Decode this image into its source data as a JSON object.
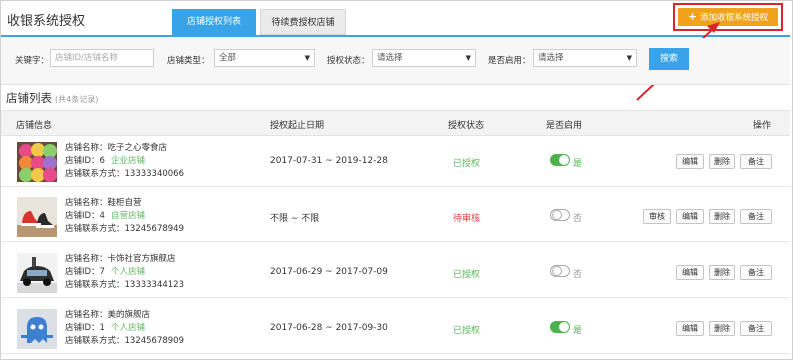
{
  "page_title": "收银系统授权",
  "tabs": [
    {
      "label": "店铺授权列表",
      "active": true
    },
    {
      "label": "待续费授权店铺",
      "active": false
    }
  ],
  "add_button": {
    "icon": "plus-icon",
    "label": "添加收银系统授权"
  },
  "filters": {
    "keyword": {
      "label": "关键字：",
      "placeholder": "店铺ID/店铺名称"
    },
    "shop_type": {
      "label": "店铺类型：",
      "value": "全部"
    },
    "auth_status": {
      "label": "授权状态：",
      "value": "请选择"
    },
    "enabled": {
      "label": "是否启用：",
      "value": "请选择"
    },
    "search_label": "搜索"
  },
  "list": {
    "title": "店铺列表",
    "count": "(共4条记录)"
  },
  "columns": [
    "店铺信息",
    "授权起止日期",
    "授权状态",
    "是否启用",
    "操作"
  ],
  "rows": [
    {
      "name": "店铺名称：吃子之心零食店",
      "id": "店铺ID：6",
      "type": "企业店铺",
      "phone": "店铺联系方式：13333340066",
      "dates": "2017-07-31 ~ 2019-12-28",
      "status": "已授权",
      "status_kind": "ok",
      "enabled": true,
      "enabled_label": "是",
      "ops": [
        "编辑",
        "删除",
        "备注"
      ],
      "thumb": "cupcakes"
    },
    {
      "name": "店铺名称：鞋柜自营",
      "id": "店铺ID：4",
      "type": "自营店铺",
      "phone": "店铺联系方式：13245678949",
      "dates": "不限 ~ 不限",
      "status": "待审核",
      "status_kind": "wait",
      "enabled": false,
      "enabled_label": "否",
      "ops": [
        "审核",
        "编辑",
        "删除",
        "备注"
      ],
      "thumb": "shoes"
    },
    {
      "name": "店铺名称：卡饰社官方旗舰店",
      "id": "店铺ID：7",
      "type": "个人店铺",
      "phone": "店铺联系方式：13333344123",
      "dates": "2017-06-29 ~ 2017-07-09",
      "status": "已授权",
      "status_kind": "ok",
      "enabled": false,
      "enabled_label": "否",
      "ops": [
        "编辑",
        "删除",
        "备注"
      ],
      "thumb": "car"
    },
    {
      "name": "店铺名称：美的旗舰店",
      "id": "店铺ID：1",
      "type": "个人店铺",
      "phone": "店铺联系方式：13245678909",
      "dates": "2017-06-28 ~ 2017-09-30",
      "status": "已授权",
      "status_kind": "ok",
      "enabled": true,
      "enabled_label": "是",
      "ops": [
        "编辑",
        "删除",
        "备注"
      ],
      "thumb": "ghost"
    }
  ],
  "colors": {
    "primary": "#38a3e6",
    "accent": "#f0a21d",
    "highlight_border": "#d9262a",
    "success": "#4cb24c",
    "danger": "#e8433f"
  }
}
